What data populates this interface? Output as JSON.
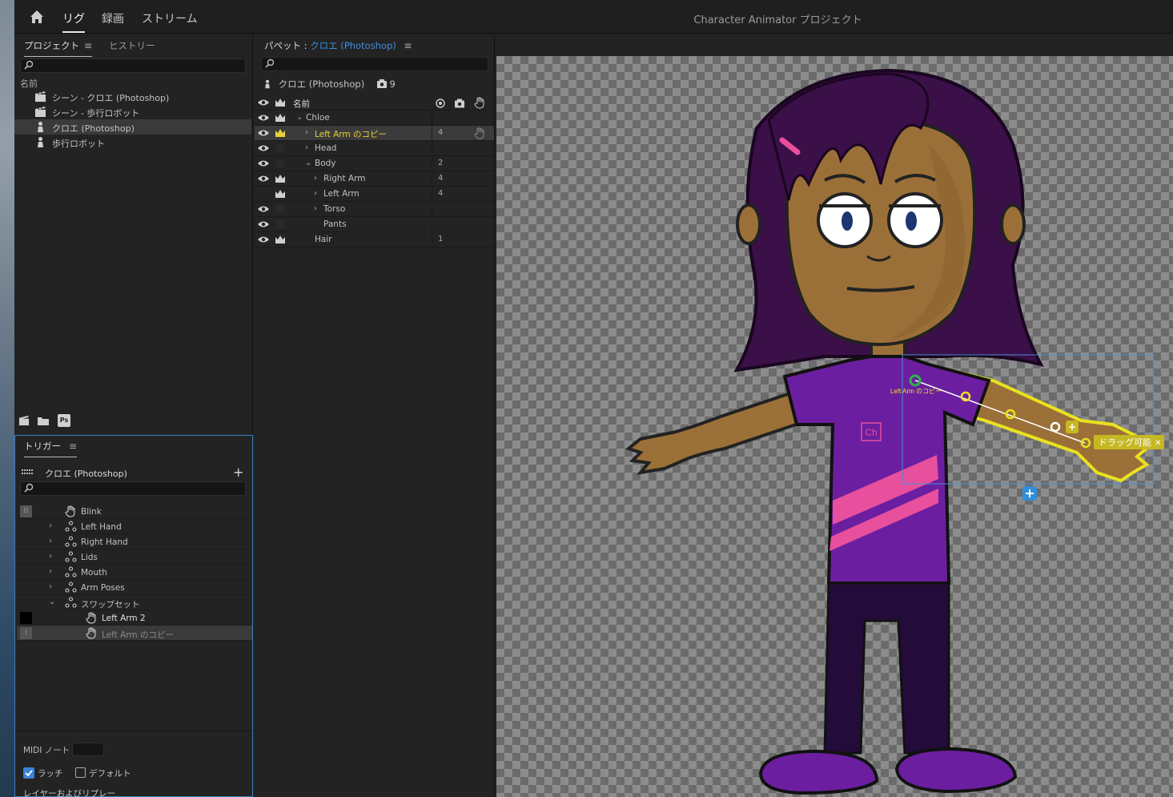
{
  "app": {
    "title": "Character Animator プロジェクト",
    "workspace_tabs": [
      "リグ",
      "録画",
      "ストリーム"
    ],
    "active_tab": "リグ"
  },
  "project_panel": {
    "tabs": [
      "プロジェクト",
      "ヒストリー"
    ],
    "column_name": "名前",
    "items": [
      {
        "label": "シーン - クロエ (Photoshop)",
        "icon": "scene-icon"
      },
      {
        "label": "シーン - 歩行ロボット",
        "icon": "scene-icon"
      },
      {
        "label": "クロエ (Photoshop)",
        "icon": "puppet-icon",
        "selected": true
      },
      {
        "label": "歩行ロボット",
        "icon": "puppet-icon"
      }
    ],
    "footer_icons": [
      "new-scene-icon",
      "folder-icon",
      "photoshop-icon"
    ],
    "ps_label": "Ps"
  },
  "puppet_panel": {
    "title_prefix": "パペット :",
    "puppet_name": "クロエ (Photoshop)",
    "info_name": "クロエ (Photoshop)",
    "info_count": "9",
    "header_name": "名前",
    "layers": [
      {
        "name": "Chloe",
        "depth": 0,
        "chevron": "down",
        "eye": true,
        "crown": true,
        "count": ""
      },
      {
        "name": "Left Arm のコピー",
        "depth": 1,
        "chevron": "right",
        "eye": true,
        "crown": true,
        "crown_yellow": true,
        "count": "4",
        "selected": true,
        "highlight": true,
        "handle": true
      },
      {
        "name": "Head",
        "depth": 1,
        "chevron": "right",
        "eye": true,
        "crown": false,
        "count": ""
      },
      {
        "name": "Body",
        "depth": 1,
        "chevron": "down",
        "eye": true,
        "crown": false,
        "count": "2"
      },
      {
        "name": "Right Arm",
        "depth": 2,
        "chevron": "right",
        "eye": true,
        "crown": true,
        "count": "4"
      },
      {
        "name": "Left Arm",
        "depth": 2,
        "chevron": "right",
        "eye": false,
        "crown": true,
        "count": "4"
      },
      {
        "name": "Torso",
        "depth": 2,
        "chevron": "right",
        "eye": true,
        "crown": false,
        "count": ""
      },
      {
        "name": "Pants",
        "depth": 2,
        "chevron": "",
        "eye": true,
        "crown": false,
        "count": ""
      },
      {
        "name": "Hair",
        "depth": 1,
        "chevron": "",
        "eye": true,
        "crown": true,
        "count": "1"
      }
    ]
  },
  "trigger_panel": {
    "title": "トリガー",
    "puppet": "クロエ (Photoshop)",
    "rows": [
      {
        "key": "B",
        "name": "Blink",
        "icon": "hand-icon",
        "chevron": "",
        "indent": 0
      },
      {
        "key": "",
        "name": "Left Hand",
        "icon": "swapset-icon",
        "chevron": "right",
        "indent": 0
      },
      {
        "key": "",
        "name": "Right Hand",
        "icon": "swapset-icon",
        "chevron": "right",
        "indent": 0
      },
      {
        "key": "",
        "name": "Lids",
        "icon": "swapset-icon",
        "chevron": "right",
        "indent": 0
      },
      {
        "key": "",
        "name": "Mouth",
        "icon": "swapset-icon",
        "chevron": "right",
        "indent": 0
      },
      {
        "key": "",
        "name": "Arm Poses",
        "icon": "swapset-icon",
        "chevron": "right",
        "indent": 0
      },
      {
        "key": "",
        "name": "スワップセット",
        "icon": "swapset-icon",
        "chevron": "down",
        "indent": 0
      },
      {
        "key": "",
        "name": "Left Arm 2",
        "icon": "hand-icon",
        "chevron": "",
        "indent": 1,
        "bold": true,
        "keyblack": true
      },
      {
        "key": "I",
        "name": "Left Arm のコピー",
        "icon": "hand-icon",
        "chevron": "",
        "indent": 1,
        "dim": true,
        "selected": true
      }
    ],
    "midi_label": "MIDI ノート",
    "latch_label": "ラッチ",
    "default_label": "デフォルト",
    "layer_replay_label": "レイヤーおよびリプレー"
  },
  "stage": {
    "tag_label": "Left Arm のコピー",
    "draggable_label": "ドラッグ可能",
    "shirt_logo": "Ch"
  },
  "colors": {
    "accent_blue": "#3d8fe0",
    "highlight_yellow": "#e7cf3a",
    "skin": "#9b7038",
    "hair": "#3b0f48",
    "shirt": "#6b1fa0",
    "pants": "#230b3a"
  }
}
